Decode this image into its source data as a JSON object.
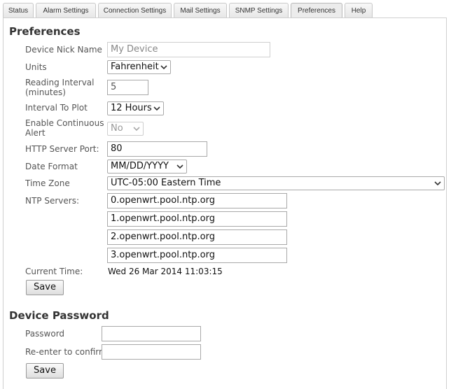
{
  "tabs": [
    {
      "label": "Status"
    },
    {
      "label": "Alarm Settings"
    },
    {
      "label": "Connection Settings"
    },
    {
      "label": "Mail Settings"
    },
    {
      "label": "SNMP Settings"
    },
    {
      "label": "Preferences"
    },
    {
      "label": "Help"
    }
  ],
  "active_tab": "Preferences",
  "preferences": {
    "title": "Preferences",
    "device_nick_name": {
      "label": "Device Nick Name",
      "placeholder": "My Device"
    },
    "units": {
      "label": "Units",
      "value": "Fahrenheit"
    },
    "reading_interval": {
      "label": "Reading Interval (minutes)",
      "value": "5"
    },
    "interval_to_plot": {
      "label": "Interval To Plot",
      "value": "12 Hours"
    },
    "continuous_alert": {
      "label": "Enable Continuous Alert",
      "value": "No"
    },
    "http_port": {
      "label": "HTTP Server Port:",
      "value": "80"
    },
    "date_format": {
      "label": "Date Format",
      "value": "MM/DD/YYYY"
    },
    "time_zone": {
      "label": "Time Zone",
      "value": "UTC-05:00 Eastern Time"
    },
    "ntp": {
      "label": "NTP Servers:",
      "servers": [
        "0.openwrt.pool.ntp.org",
        "1.openwrt.pool.ntp.org",
        "2.openwrt.pool.ntp.org",
        "3.openwrt.pool.ntp.org"
      ]
    },
    "current_time": {
      "label": "Current Time:",
      "value": "Wed 26 Mar 2014 11:03:15"
    },
    "save_label": "Save"
  },
  "password": {
    "title": "Device Password",
    "password_label": "Password",
    "confirm_label": "Re-enter to confirm",
    "save_label": "Save"
  }
}
